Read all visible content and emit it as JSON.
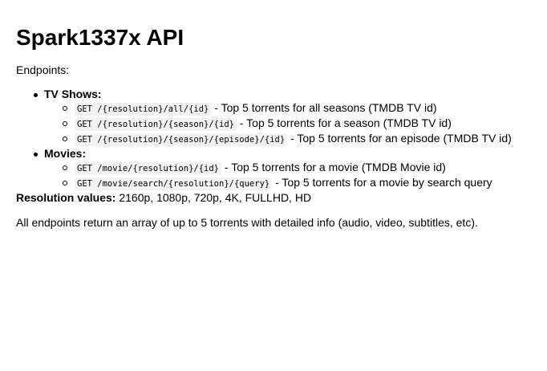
{
  "title": "Spark1337x API",
  "intro": "Endpoints:",
  "groups": [
    {
      "label": "TV Shows:",
      "endpoints": [
        {
          "code": "GET /{resolution}/all/{id}",
          "desc": "- Top 5 torrents for all seasons (TMDB TV id)"
        },
        {
          "code": "GET /{resolution}/{season}/{id}",
          "desc": "- Top 5 torrents for a season (TMDB TV id)"
        },
        {
          "code": "GET /{resolution}/{season}/{episode}/{id}",
          "desc": "- Top 5 torrents for an episode (TMDB TV id)"
        }
      ]
    },
    {
      "label": "Movies:",
      "endpoints": [
        {
          "code": "GET /movie/{resolution}/{id}",
          "desc": "- Top 5 torrents for a movie (TMDB Movie id)"
        },
        {
          "code": "GET /movie/search/{resolution}/{query}",
          "desc": "- Top 5 torrents for a movie by search query"
        }
      ]
    }
  ],
  "resolution": {
    "label": "Resolution values:",
    "values": "2160p, 1080p, 720p, 4K, FULLHD, HD"
  },
  "footer": "All endpoints return an array of up to 5 torrents with detailed info (audio, video, subtitles, etc).",
  "colors": {
    "text": "#000000",
    "code_background": "#f2f2f2",
    "page_background": "#ffffff"
  }
}
